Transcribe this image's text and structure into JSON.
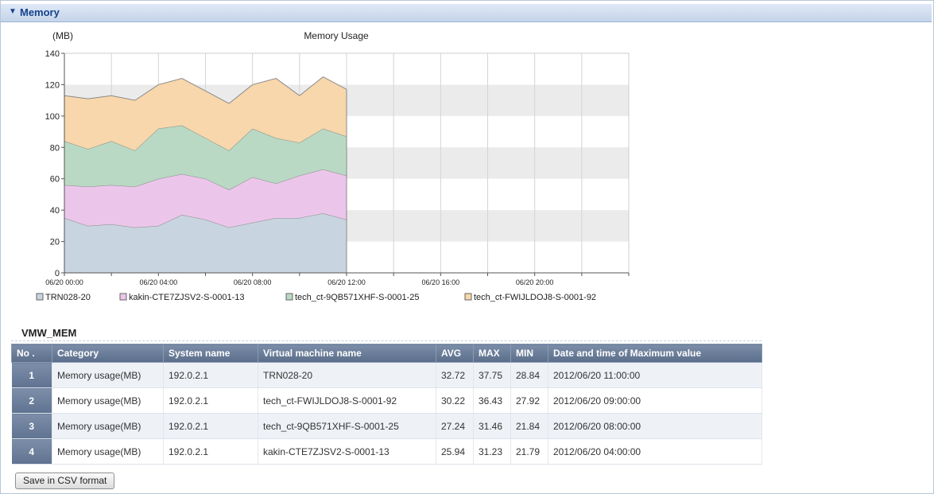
{
  "section": {
    "title": "Memory"
  },
  "chart_data": {
    "type": "area",
    "stacked": true,
    "title": "Memory Usage",
    "ylabel": "(MB)",
    "ylim": [
      0,
      140
    ],
    "yticks": [
      0,
      20,
      40,
      60,
      80,
      100,
      120,
      140
    ],
    "x_slots": 25,
    "x_tick_labels": [
      {
        "slot": 0,
        "label": "06/20 00:00"
      },
      {
        "slot": 4,
        "label": "06/20 04:00"
      },
      {
        "slot": 8,
        "label": "06/20 08:00"
      },
      {
        "slot": 12,
        "label": "06/20 12:00"
      },
      {
        "slot": 16,
        "label": "06/20 16:00"
      },
      {
        "slot": 20,
        "label": "06/20 20:00"
      }
    ],
    "series": [
      {
        "name": "TRN028-20",
        "color": "#c8d4e0",
        "values": [
          35,
          30,
          31,
          29,
          30,
          37,
          34,
          29,
          32,
          35,
          35,
          38,
          34
        ]
      },
      {
        "name": "kakin-CTE7ZJSV2-S-0001-13",
        "color": "#ecc6ea",
        "values": [
          21,
          25,
          25,
          26,
          30,
          26,
          26,
          24,
          29,
          22,
          27,
          28,
          28
        ]
      },
      {
        "name": "tech_ct-9QB571XHF-S-0001-25",
        "color": "#b9d9c4",
        "values": [
          28,
          24,
          28,
          23,
          32,
          31,
          26,
          25,
          31,
          29,
          21,
          26,
          25
        ]
      },
      {
        "name": "tech_ct-FWIJLDOJ8-S-0001-92",
        "color": "#f7d7ab",
        "values": [
          29,
          32,
          29,
          32,
          28,
          30,
          30,
          30,
          28,
          38,
          30,
          33,
          30
        ]
      }
    ]
  },
  "table": {
    "title": "VMW_MEM",
    "headers": [
      "No .",
      "Category",
      "System name",
      "Virtual machine name",
      "AVG",
      "MAX",
      "MIN",
      "Date and time of Maximum value"
    ],
    "rows": [
      [
        "1",
        "Memory usage(MB)",
        "192.0.2.1",
        "TRN028-20",
        "32.72",
        "37.75",
        "28.84",
        "2012/06/20 11:00:00"
      ],
      [
        "2",
        "Memory usage(MB)",
        "192.0.2.1",
        "tech_ct-FWIJLDOJ8-S-0001-92",
        "30.22",
        "36.43",
        "27.92",
        "2012/06/20 09:00:00"
      ],
      [
        "3",
        "Memory usage(MB)",
        "192.0.2.1",
        "tech_ct-9QB571XHF-S-0001-25",
        "27.24",
        "31.46",
        "21.84",
        "2012/06/20 08:00:00"
      ],
      [
        "4",
        "Memory usage(MB)",
        "192.0.2.1",
        "kakin-CTE7ZJSV2-S-0001-13",
        "25.94",
        "31.23",
        "21.79",
        "2012/06/20 04:00:00"
      ]
    ]
  },
  "buttons": {
    "save_csv": "Save in CSV format"
  }
}
